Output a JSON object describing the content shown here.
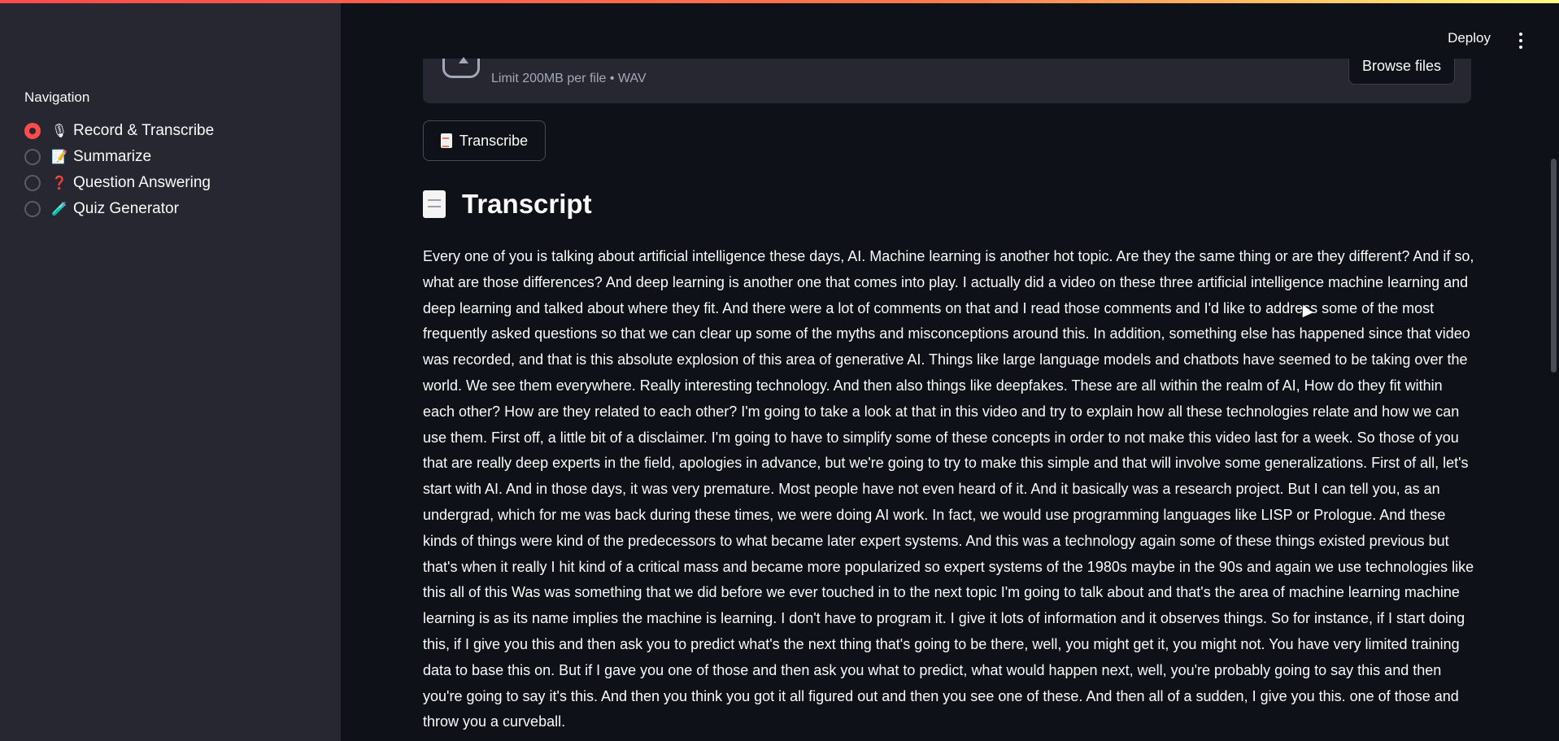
{
  "header": {
    "deploy_label": "Deploy"
  },
  "sidebar": {
    "title": "Navigation",
    "items": [
      {
        "emoji": "🎙",
        "label": "Record & Transcribe",
        "selected": true
      },
      {
        "emoji": "📝",
        "label": "Summarize",
        "selected": false
      },
      {
        "emoji": "❓",
        "label": "Question Answering",
        "selected": false
      },
      {
        "emoji": "🧪",
        "label": "Quiz Generator",
        "selected": false
      }
    ]
  },
  "uploader": {
    "hint": "Limit 200MB per file • WAV",
    "browse_label": "Browse files"
  },
  "actions": {
    "transcribe_label": "Transcribe"
  },
  "transcript": {
    "heading": "Transcript",
    "text": "Every one of you is talking about artificial intelligence these days, AI. Machine learning is another hot topic. Are they the same thing or are they different? And if so, what are those differences? And deep learning is another one that comes into play. I actually did a video on these three artificial intelligence machine learning and deep learning and talked about where they fit. And there were a lot of comments on that and I read those comments and I'd like to address some of the most frequently asked questions so that we can clear up some of the myths and misconceptions around this. In addition, something else has happened since that video was recorded, and that is this absolute explosion of this area of generative AI. Things like large language models and chatbots have seemed to be taking over the world. We see them everywhere. Really interesting technology. And then also things like deepfakes. These are all within the realm of AI, How do they fit within each other? How are they related to each other? I'm going to take a look at that in this video and try to explain how all these technologies relate and how we can use them. First off, a little bit of a disclaimer. I'm going to have to simplify some of these concepts in order to not make this video last for a week. So those of you that are really deep experts in the field, apologies in advance, but we're going to try to make this simple and that will involve some generalizations. First of all, let's start with AI. And in those days, it was very premature. Most people have not even heard of it. And it basically was a research project. But I can tell you, as an undergrad, which for me was back during these times, we were doing AI work. In fact, we would use programming languages like LISP or Prologue. And these kinds of things were kind of the predecessors to what became later expert systems. And this was a technology again some of these things existed previous but that's when it really I hit kind of a critical mass and became more popularized so expert systems of the 1980s maybe in the 90s and again we use technologies like this all of this Was was something that we did before we ever touched in to the next topic I'm going to talk about and that's the area of machine learning machine learning is as its name implies the machine is learning. I don't have to program it. I give it lots of information and it observes things. So for instance, if I start doing this, if I give you this and then ask you to predict what's the next thing that's going to be there, well, you might get it, you might not. You have very limited training data to base this on. But if I gave you one of those and then ask you what to predict, what would happen next, well, you're probably going to say this and then you're going to say it's this. And then you think you got it all figured out and then you see one of these. And then all of a sudden, I give you this. one of those and throw you a curveball."
  }
}
